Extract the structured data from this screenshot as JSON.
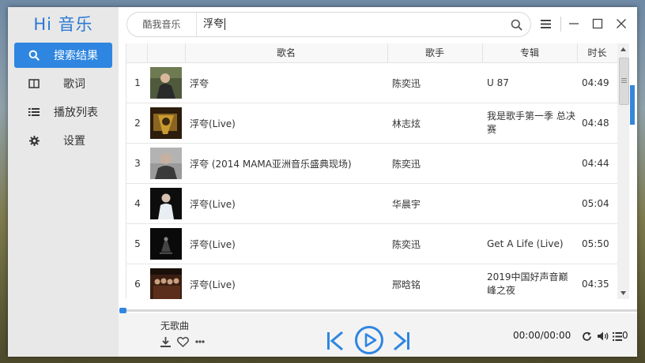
{
  "app": {
    "logo": "Hi 音乐"
  },
  "sidebar": {
    "items": [
      {
        "label": "搜索结果",
        "icon": "search-icon",
        "active": true
      },
      {
        "label": "歌词",
        "icon": "lyrics-icon",
        "active": false
      },
      {
        "label": "播放列表",
        "icon": "playlist-icon",
        "active": false
      },
      {
        "label": "设置",
        "icon": "gear-icon",
        "active": false
      }
    ]
  },
  "search": {
    "source": "酷我音乐",
    "query": "浮夸"
  },
  "table": {
    "headers": {
      "title": "歌名",
      "artist": "歌手",
      "album": "专辑",
      "duration": "时长"
    },
    "rows": [
      {
        "num": "1",
        "title": "浮夸",
        "artist": "陈奕迅",
        "album": "U 87",
        "duration": "04:49"
      },
      {
        "num": "2",
        "title": "浮夸(Live)",
        "artist": "林志炫",
        "album": "我是歌手第一季 总决赛",
        "duration": "04:48"
      },
      {
        "num": "3",
        "title": "浮夸 (2014 MAMA亚洲音乐盛典现场)",
        "artist": "陈奕迅",
        "album": "",
        "duration": "04:44"
      },
      {
        "num": "4",
        "title": "浮夸(Live)",
        "artist": "华晨宇",
        "album": "",
        "duration": "05:04"
      },
      {
        "num": "5",
        "title": "浮夸(Live)",
        "artist": "陈奕迅",
        "album": "Get A Life (Live)",
        "duration": "05:50"
      },
      {
        "num": "6",
        "title": "浮夸(Live)",
        "artist": "邢晗铭",
        "album": "2019中国好声音巅峰之夜",
        "duration": "04:35"
      }
    ]
  },
  "player": {
    "song": "无歌曲",
    "time": "00:00/00:00",
    "playlist_count": "0",
    "progress": 0
  },
  "colors": {
    "accent": "#2f86e0",
    "sidebar_bg": "#e8e8e8",
    "player_bg": "#f3f3f3"
  }
}
